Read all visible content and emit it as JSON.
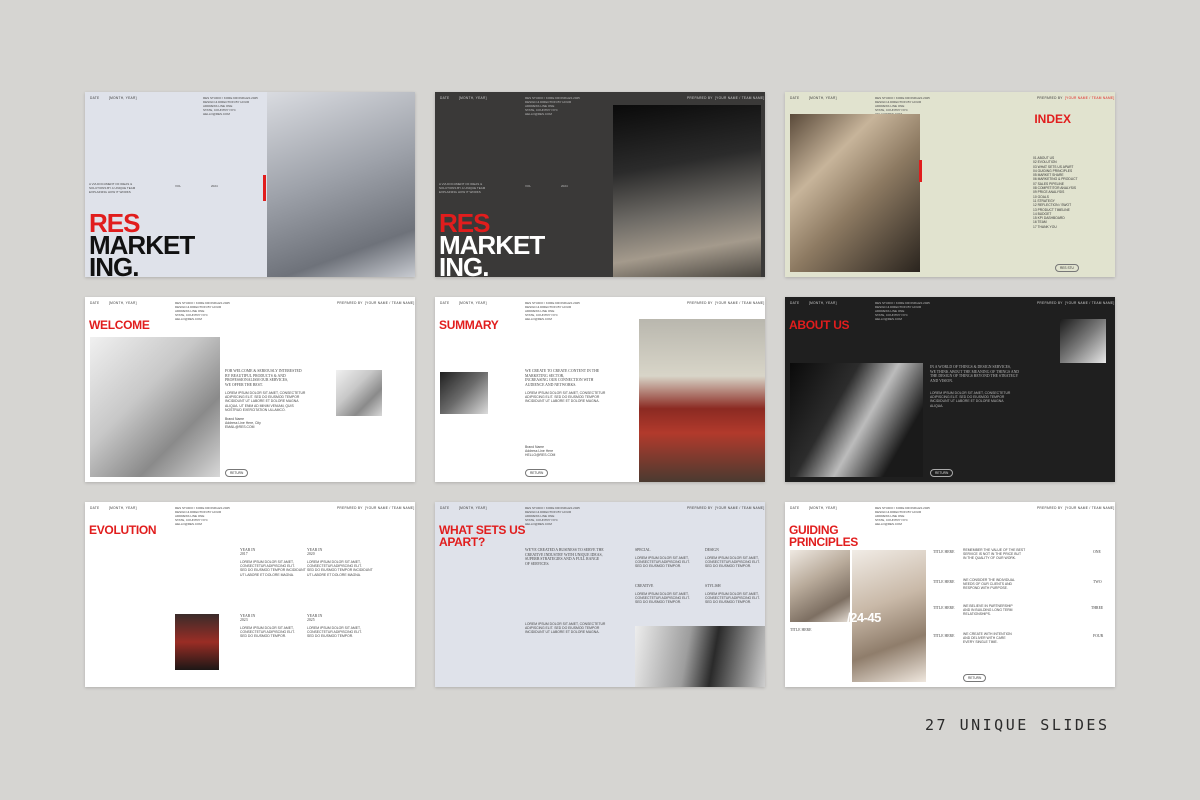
{
  "caption": "27 UNIQUE SLIDES",
  "header": {
    "left": "DATE",
    "dept": "[MONTH, YEAR]",
    "prepared": "PREPARED BY",
    "names": "[YOUR NAME / TEAM NAME]",
    "contact": "RES STUDIO / KORE KRONIKLES 2025\nDESIGN & DIRECTION BY HOUR\nADDRESS LINE ONE\nSTATE, COUNTRY NYC\nHELLO@RES.COM"
  },
  "slides": {
    "cover": {
      "line1": "RES",
      "line2": "MARKET",
      "line3": "ING.",
      "meta": "A VIA DOCUMENT OF IDEAS &\nSOLUTIONS BY A UNIQUE TEAM\nEXPLAINING HOW IT WORKS",
      "mid": "VOL",
      "mid2": "2024"
    },
    "index": {
      "title": "INDEX",
      "items": [
        "01  ABOUT US",
        "02  EVOLUTION",
        "03  WHAT SETS US APART",
        "04  GUIDING PRINCIPLES",
        "05  MARKET SHARE",
        "06  MARKETING & PRODUCT",
        "07  SALES PIPELINE",
        "08  COMPETITOR ANALYSIS",
        "09  PRICE ANALYSIS",
        "10  GOALS",
        "11  STRATEGY",
        "12  REFLECTION / SWOT",
        "13  PRODUCT TIMELINE",
        "14  BUDGET",
        "15  KPI DASHBOARD",
        "16  TEAM",
        "17  THANK YOU"
      ],
      "btn": "RES STU"
    },
    "welcome": {
      "title": "WELCOME",
      "lead": "FOR WELCOME & SERIOUSLY INTERESTED\nBY BEAUTIFUL PRODUCTS & AND\nPROFESSIONALISM OUR SERVICES,\nWE OFFER THE BEST.",
      "body": "LOREM IPSUM DOLOR SIT AMET, CONSECTETUR\nADIPISCING ELIT. SED DO EIUSMOD TEMPOR\nINCIDIDUNT UT LABORE ET DOLORE MAGNA\nALIQUA. UT ENIM AD MINIM VENIAM, QUIS\nNOSTRUD EXERCITATION ULLAMCO.",
      "sign": "Brand Name\nAddress Line Here, City\nEMAIL@RES.COM",
      "btn": "RETURN"
    },
    "summary": {
      "title": "SUMMARY",
      "lead": "WE CREATE TO CREATE CONTENT IN THE\nMARKETING SECTOR,\nINCREASING OUR CONNECTION WITH\nAUDIENCE AND NETWORKS.",
      "body": "LOREM IPSUM DOLOR SIT AMET, CONSECTETUR\nADIPISCING ELIT. SED DO EIUSMOD TEMPOR\nINCIDIDUNT UT LABORE ET DOLORE MAGNA.",
      "sign": "Brand Name\nAddress Line Here\nHELLO@RES.COM",
      "btn": "RETURN"
    },
    "about": {
      "title": "ABOUT US",
      "lead": "IN A WORLD OF THINGS & DESIGN SERVICES,\nWE THINK ABOUT THE MEANING OF THINGS AND\nTHE DESIGN OF THINGS BEYOND THE STRATEGY\nAND VISION.",
      "body": "LOREM IPSUM DOLOR SIT AMET, CONSECTETUR\nADIPISCING ELIT. SED DO EIUSMOD TEMPOR\nINCIDIDUNT UT LABORE ET DOLORE MAGNA\nALIQUA.",
      "btn": "RETURN"
    },
    "evolution": {
      "title": "EVOLUTION",
      "years": [
        {
          "label": "YEAR IN\n2017",
          "text": "LOREM IPSUM DOLOR SIT AMET,\nCONSECTETUR ADIPISCING ELIT.\nSED DO EIUSMOD TEMPOR INCIDIDUNT\nUT LABORE ET DOLORE MAGNA."
        },
        {
          "label": "YEAR IN\n2020",
          "text": "LOREM IPSUM DOLOR SIT AMET,\nCONSECTETUR ADIPISCING ELIT.\nSED DO EIUSMOD TEMPOR INCIDIDUNT\nUT LABORE ET DOLORE MAGNA."
        },
        {
          "label": "YEAR IN\n2023",
          "text": "LOREM IPSUM DOLOR SIT AMET,\nCONSECTETUR ADIPISCING ELIT.\nSED DO EIUSMOD TEMPOR."
        },
        {
          "label": "YEAR IN\n2025",
          "text": "LOREM IPSUM DOLOR SIT AMET,\nCONSECTETUR ADIPISCING ELIT.\nSED DO EIUSMOD TEMPOR."
        }
      ]
    },
    "apart": {
      "title": "WHAT SETS US\nAPART?",
      "lead": "WE'VE CREATED A BUSINESS TO SERVE THE\nCREATIVE INDUSTRY WITH UNIQUE IDEAS,\nSUPERB STRATEGIES AND A FULL RANGE\nOF SERVICES.",
      "cols": [
        {
          "h": "SPECIAL",
          "t": "LOREM IPSUM DOLOR SIT AMET,\nCONSECTETUR ADIPISCING ELIT.\nSED DO EIUSMOD TEMPOR."
        },
        {
          "h": "DESIGN",
          "t": "LOREM IPSUM DOLOR SIT AMET,\nCONSECTETUR ADIPISCING ELIT.\nSED DO EIUSMOD TEMPOR."
        },
        {
          "h": "CREATIVE",
          "t": "LOREM IPSUM DOLOR SIT AMET,\nCONSECTETUR ADIPISCING ELIT.\nSED DO EIUSMOD TEMPOR."
        },
        {
          "h": "STYLISH",
          "t": "LOREM IPSUM DOLOR SIT AMET,\nCONSECTETUR ADIPISCING ELIT.\nSED DO EIUSMOD TEMPOR."
        }
      ],
      "body": "LOREM IPSUM DOLOR SIT AMET, CONSECTETUR\nADIPISCING ELIT. SED DO EIUSMOD TEMPOR\nINCIDIDUNT UT LABORE ET DOLORE MAGNA."
    },
    "principles": {
      "title": "GUIDING\nPRINCIPLES",
      "number": "/24-45",
      "caption": "TITLE HERE",
      "rows": [
        {
          "label": "TITLE HERE",
          "text": "REMEMBER THE VALUE OF THE BEST\nSERVICE IS NOT IN THE PRICE BUT\nIN THE QUALITY OF OUR WORK.",
          "num": "ONE"
        },
        {
          "label": "TITLE HERE",
          "text": "WE CONSIDER THE INDIVIDUAL\nNEEDS OF OUR CLIENTS AND\nRESPOND WITH PURPOSE.",
          "num": "TWO"
        },
        {
          "label": "TITLE HERE",
          "text": "WE BELIEVE IN PARTNERSHIP\nAND IN BUILDING LONG TERM\nRELATIONSHIPS.",
          "num": "THREE"
        },
        {
          "label": "TITLE HERE",
          "text": "WE CREATE WITH INTENTION\nAND DELIVER WITH CARE\nEVERY SINGLE TIME.",
          "num": "FOUR"
        }
      ],
      "btn": "RETURN"
    }
  }
}
